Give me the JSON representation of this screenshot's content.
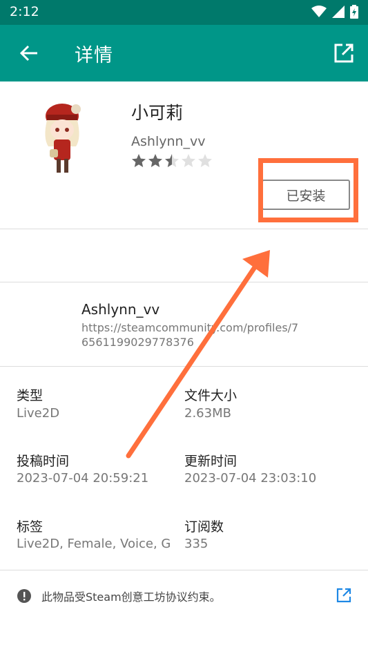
{
  "statusbar": {
    "time": "2:12"
  },
  "appbar": {
    "title": "详情"
  },
  "item": {
    "name": "小可莉",
    "author": "Ashlynn_vv",
    "rating_stars": 2.5,
    "rating_max": 5,
    "install_button": "已安装"
  },
  "creator": {
    "name": "Ashlynn_vv",
    "url": "https://steamcommunity.com/profiles/76561199029778376"
  },
  "details": {
    "type_label": "类型",
    "type_value": "Live2D",
    "size_label": "文件大小",
    "size_value": "2.63MB",
    "posted_label": "投稿时间",
    "posted_value": "2023-07-04 20:59:21",
    "updated_label": "更新时间",
    "updated_value": "2023-07-04 23:03:10",
    "tags_label": "标签",
    "tags_value": "Live2D, Female, Voice, G",
    "subs_label": "订阅数",
    "subs_value": "335"
  },
  "notice": {
    "text": "此物品受Steam创意工坊协议约束。"
  },
  "colors": {
    "statusbar": "#00796b",
    "appbar": "#009688",
    "annotation": "#ff6f3c",
    "link_icon": "#1e88e5"
  }
}
